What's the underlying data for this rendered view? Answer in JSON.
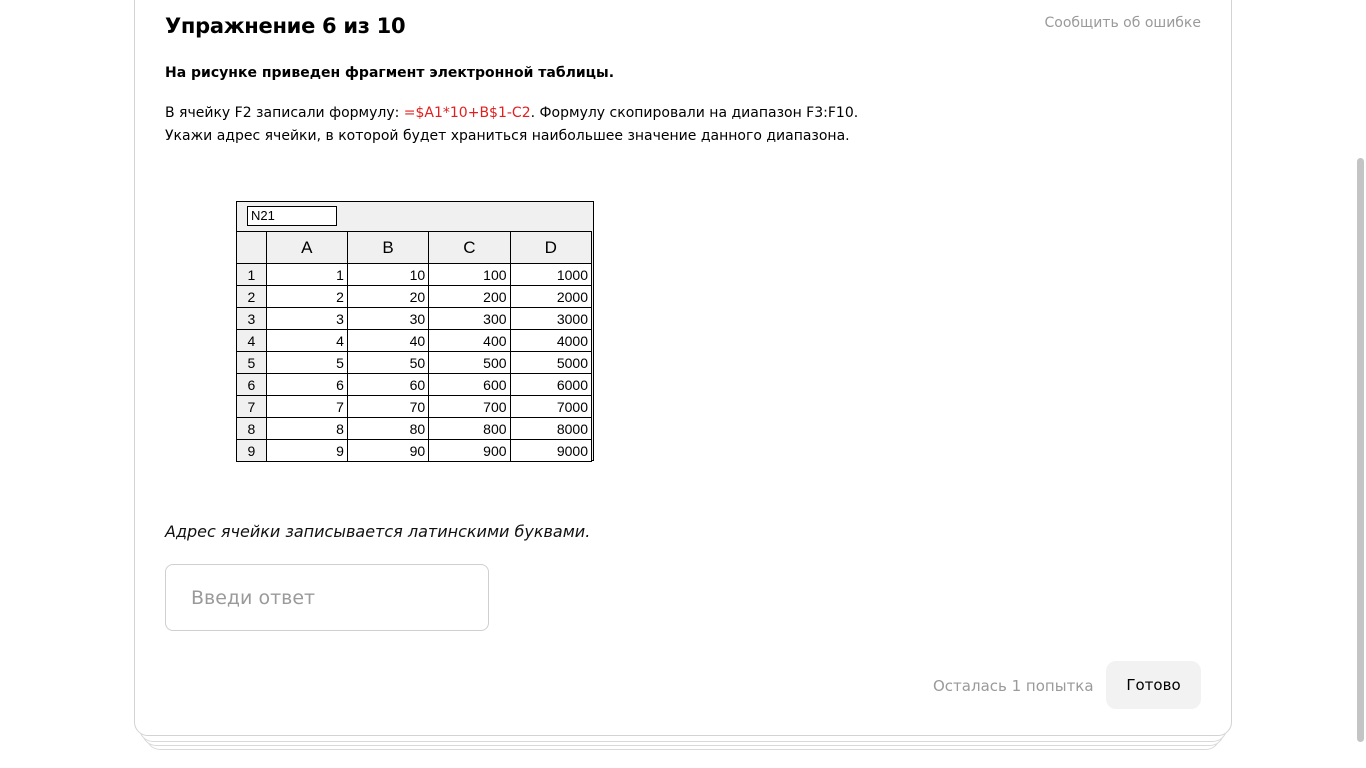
{
  "header": {
    "title": "Упражнение 6 из 10",
    "report_link": "Сообщить об ошибке"
  },
  "question": {
    "lead": "На рисунке приведен фрагмент электронной таблицы.",
    "text_before": "В ячейку F2 записали формулу: ",
    "formula": "=$A1*10+B$1-C2",
    "text_after": ". Формулу скопировали на диапазон F3:F10. Укажи адрес ячейки, в которой будет храниться наибольшее значение данного диапазона."
  },
  "spreadsheet": {
    "name_box": "N21",
    "columns": [
      "A",
      "B",
      "C",
      "D"
    ],
    "rows": [
      {
        "label": "1",
        "cells": [
          "1",
          "10",
          "100",
          "1000"
        ]
      },
      {
        "label": "2",
        "cells": [
          "2",
          "20",
          "200",
          "2000"
        ]
      },
      {
        "label": "3",
        "cells": [
          "3",
          "30",
          "300",
          "3000"
        ]
      },
      {
        "label": "4",
        "cells": [
          "4",
          "40",
          "400",
          "4000"
        ]
      },
      {
        "label": "5",
        "cells": [
          "5",
          "50",
          "500",
          "5000"
        ]
      },
      {
        "label": "6",
        "cells": [
          "6",
          "60",
          "600",
          "6000"
        ]
      },
      {
        "label": "7",
        "cells": [
          "7",
          "70",
          "700",
          "7000"
        ]
      },
      {
        "label": "8",
        "cells": [
          "8",
          "80",
          "800",
          "8000"
        ]
      },
      {
        "label": "9",
        "cells": [
          "9",
          "90",
          "900",
          "9000"
        ]
      }
    ]
  },
  "hint": "Адрес ячейки записывается латинскими буквами.",
  "answer": {
    "placeholder": "Введи ответ",
    "value": ""
  },
  "footer": {
    "attempts_text": "Осталась 1 попытка",
    "submit_label": "Готово"
  },
  "colors": {
    "formula": "#e02020",
    "muted": "#9a9a9a",
    "button_bg": "#f2f2f2"
  }
}
